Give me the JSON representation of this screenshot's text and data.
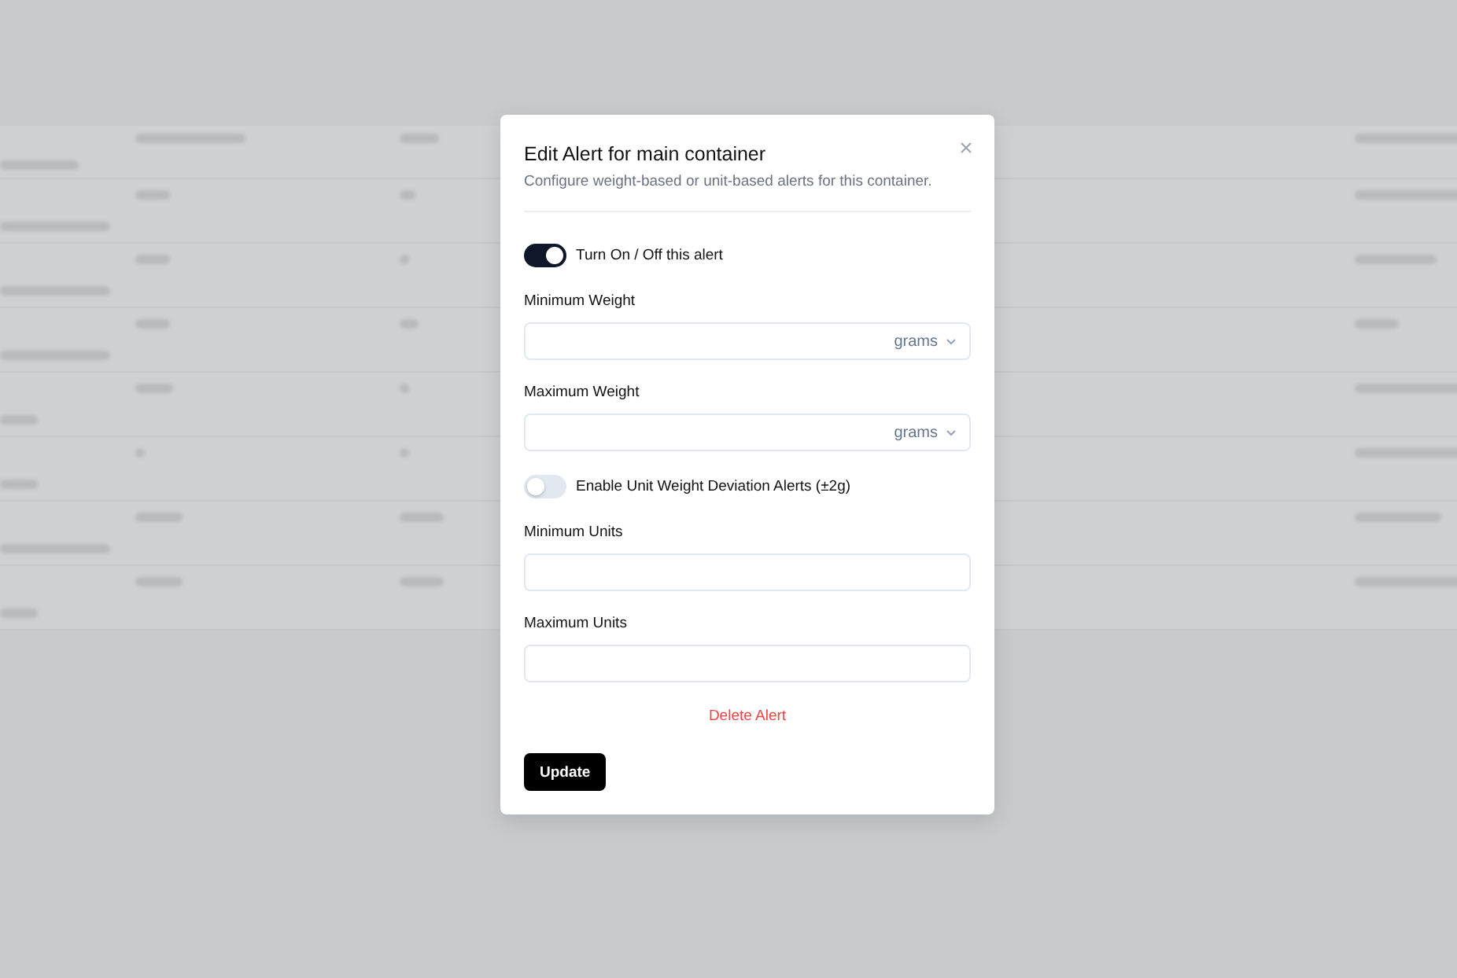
{
  "dialog": {
    "title": "Edit Alert for main container",
    "description": "Configure weight-based or unit-based alerts for this container.",
    "fields": [
      {
        "kind": "switch",
        "label": "Turn On / Off this alert",
        "on": true
      },
      {
        "kind": "unit-input",
        "label": "Minimum Weight",
        "unit": "grams"
      },
      {
        "kind": "unit-input",
        "label": "Maximum Weight",
        "unit": "grams"
      },
      {
        "kind": "switch",
        "label": "Enable Unit Weight Deviation Alerts (±2g)",
        "on": false
      },
      {
        "kind": "input",
        "label": "Minimum Units"
      },
      {
        "kind": "input",
        "label": "Maximum Units"
      }
    ],
    "delete_label": "Delete Alert",
    "submit_label": "Update"
  }
}
